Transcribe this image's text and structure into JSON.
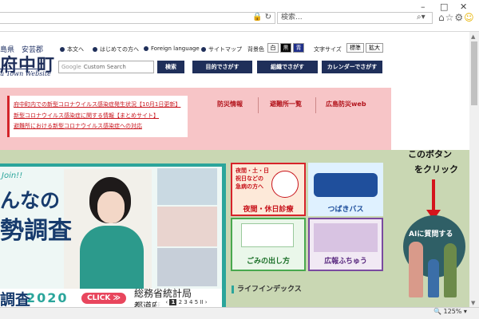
{
  "browser": {
    "search_placeholder": "検索...",
    "zoom": "125%",
    "window_min": "–",
    "window_restore": "□",
    "window_close": "✕"
  },
  "site": {
    "logo_top": "島県　安芸郡",
    "logo_main": "府中町",
    "logo_sub": "u Town Website",
    "links": [
      "本文へ",
      "はじめての方へ",
      "Foreign language",
      "サイトマップ"
    ],
    "bg_color_label": "背景色",
    "bg_options": [
      "白",
      "黒",
      "青"
    ],
    "font_size_label": "文字サイズ",
    "font_options": [
      "標準",
      "拡大"
    ],
    "search_placeholder": "Custom Search",
    "search_google": "Google",
    "search_button": "検索",
    "nav": [
      "目的でさがす",
      "組織でさがす",
      "カレンダーでさがす"
    ]
  },
  "notice": {
    "links": [
      "府中町内での新型コロナウイルス感染症発生状況【10月1日更新】",
      "新型コロナウイルス感染症に関する情報【まとめサイト】",
      "避難所における新型コロナウイルス感染症への対応"
    ],
    "nav": [
      "防災情報",
      "避難所一覧",
      "広島防災web"
    ]
  },
  "banner": {
    "join": "Join!!",
    "line1": "んなの",
    "line2": "勢調査",
    "chosa": "調査",
    "year": "2020",
    "click": "CLICK ≫",
    "org1": "総務省統計局",
    "org2": "都道府",
    "pager": [
      "1",
      "2",
      "3",
      "4",
      "5"
    ],
    "pager_prev": "‹",
    "pager_next": "›",
    "pager_pause": "II"
  },
  "tiles": [
    {
      "label": "夜間・休日診療",
      "sub": "夜間・土・日\n祝日などの\n急病の方へ"
    },
    {
      "label": "つばきバス",
      "sub": ""
    },
    {
      "label": "ごみの出し方",
      "sub": ""
    },
    {
      "label": "広報ふちゅう",
      "sub": ""
    }
  ],
  "life_index": "ライフインデックス",
  "ai": {
    "note1": "このボタン",
    "note2": "をクリック",
    "button": "AIに質問する"
  },
  "colors": {
    "navy": "#1f2f5a",
    "notice_bg": "#f7c5c7",
    "notice_red": "#c8141c",
    "teal": "#2ba59b",
    "sage": "#c9d7b3",
    "arrow_red": "#d4141c"
  }
}
